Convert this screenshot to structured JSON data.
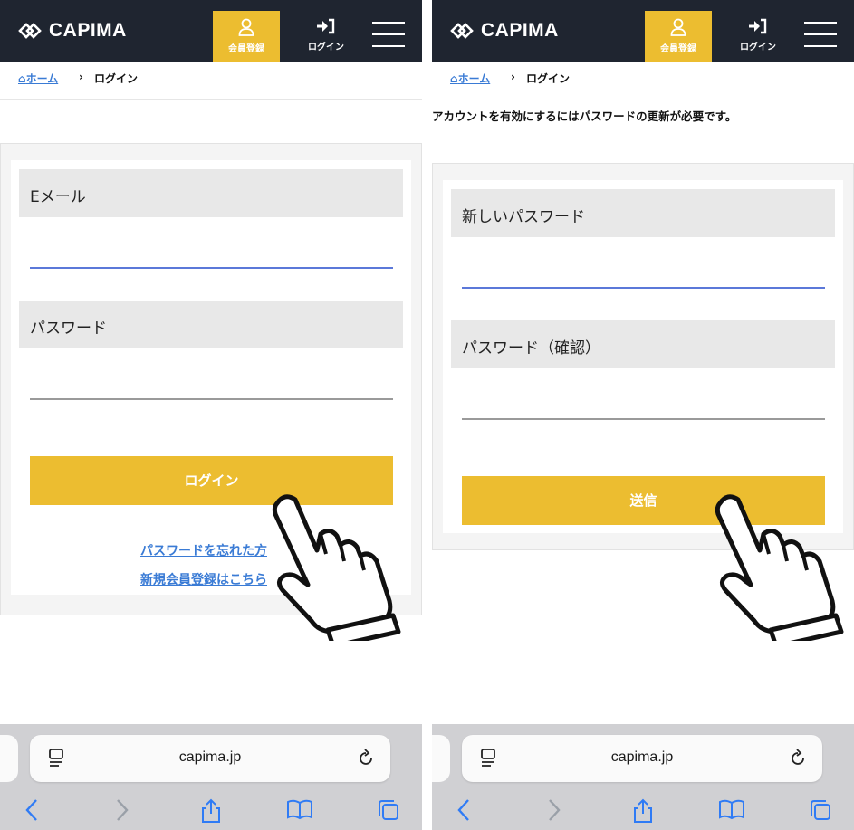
{
  "brand": {
    "name": "CAPIMA"
  },
  "header": {
    "register_label": "会員登録",
    "login_label": "ログイン"
  },
  "breadcrumb": {
    "home": "ホーム",
    "separator": "›",
    "current": "ログイン"
  },
  "left_screen": {
    "email_label": "Eメール",
    "password_label": "パスワード",
    "login_button": "ログイン",
    "forgot_link": "パスワードを忘れた方",
    "signup_link": "新規会員登録はこちら"
  },
  "right_screen": {
    "notice": "アカウントを有効にするにはパスワードの更新が必要です。",
    "new_password_label": "新しいパスワード",
    "confirm_password_label": "パスワード（確認）",
    "submit_button": "送信"
  },
  "browser": {
    "url": "capima.jp"
  },
  "icons": [
    "logo-icon",
    "user-icon",
    "login-icon",
    "menu-icon",
    "reader-icon",
    "reload-icon",
    "back-icon",
    "forward-icon",
    "share-icon",
    "bookmarks-icon",
    "tabs-icon",
    "pointing-hand-icon"
  ],
  "colors": {
    "header_bg": "#1f2530",
    "accent": "#ecbd30",
    "link": "#3a7bd5",
    "toolbar_bg": "#d0d0d3"
  }
}
